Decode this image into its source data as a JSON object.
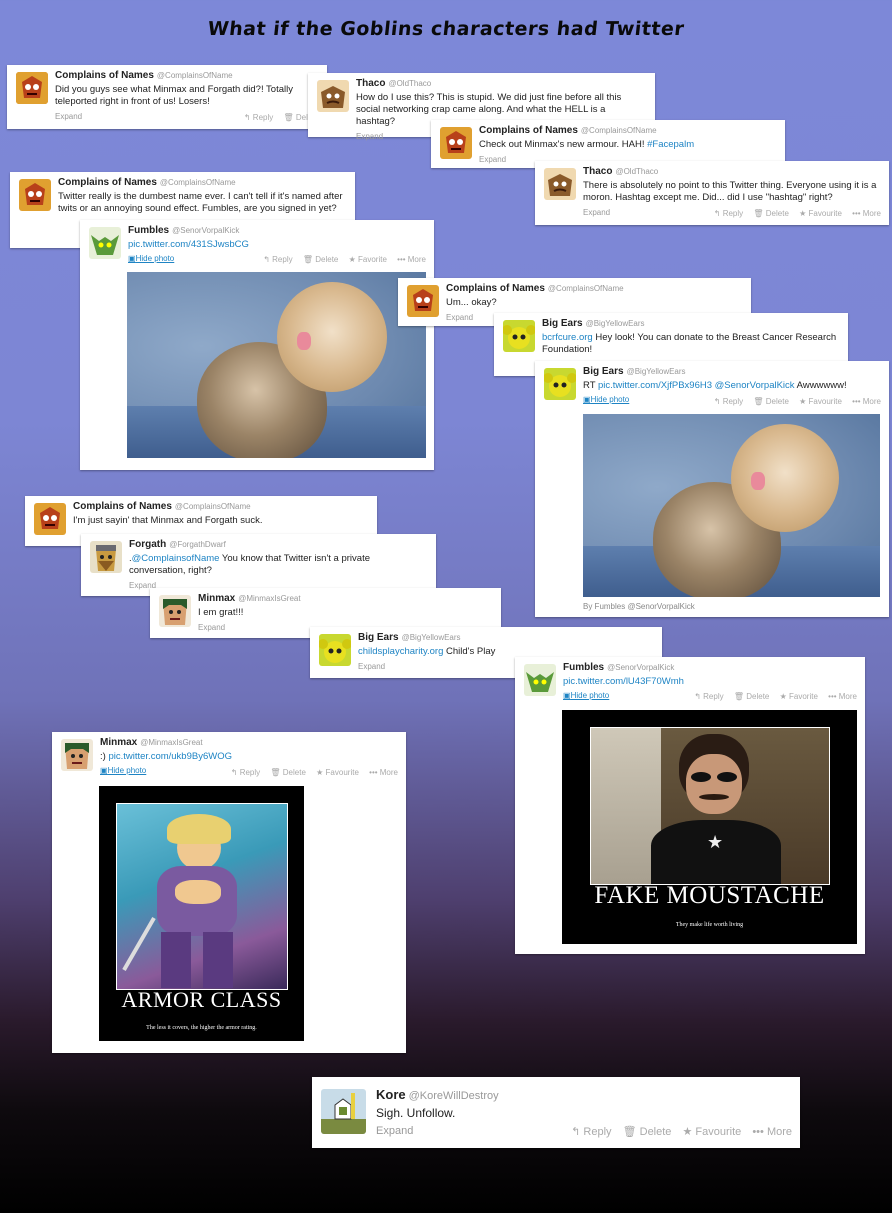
{
  "page_title": "What if the Goblins characters had Twitter",
  "actions": {
    "reply": "Reply",
    "delete": "Delete",
    "favorite": "Favorite",
    "favourite": "Favourite",
    "more": "More",
    "expand": "Expand",
    "hide_photo": "Hide photo"
  },
  "tweets": [
    {
      "name": "Complains of Names",
      "handle": "@ComplainsOfName",
      "text": "Did you guys see what Minmax and Forgath did?! Totally teleported right in front of us! Losers!"
    },
    {
      "name": "Thaco",
      "handle": "@OldThaco",
      "text": "How do I use this? This is stupid. We did just fine before all this social networking crap came along. And what the HELL is a hashtag?"
    },
    {
      "name": "Complains of Names",
      "handle": "@ComplainsOfName",
      "text": "Check out Minmax's new armour. HAH! ",
      "link": "#Facepalm"
    },
    {
      "name": "Thaco",
      "handle": "@OldThaco",
      "text": "There is absolutely no point to this Twitter thing. Everyone using it is a moron. Hashtag except me. Did... did I use \"hashtag\" right?"
    },
    {
      "name": "Complains of Names",
      "handle": "@ComplainsOfName",
      "text": "Twitter really is the dumbest name ever. I can't tell if it's named after twits or an annoying sound effect. Fumbles, are you signed in yet?"
    },
    {
      "name": "Fumbles",
      "handle": "@SenorVorpalKick",
      "link": "pic.twitter.com/431SJwsbCG"
    },
    {
      "name": "Complains of Names",
      "handle": "@ComplainsOfName",
      "text": "Um... okay?"
    },
    {
      "name": "Big Ears",
      "handle": "@BigYellowEars",
      "link": "bcrfcure.org",
      "text": "  Hey look! You can donate to the Breast Cancer Research Foundation!"
    },
    {
      "name": "Big Ears",
      "handle": "@BigYellowEars",
      "prefix": "RT ",
      "link": "pic.twitter.com/XjfPBx96H3",
      "link2": " @SenorVorpalKick",
      "text": " Awwwwww!",
      "byline": "By Fumbles @SenorVorpalKick"
    },
    {
      "name": "Complains of Names",
      "handle": "@ComplainsOfName",
      "text": "I'm just sayin' that Minmax and Forgath suck."
    },
    {
      "name": "Forgath",
      "handle": "@ForgathDwarf",
      "prefix": ".",
      "link": "@ComplainsofName",
      "text": " You know that Twitter isn't a private conversation, right?"
    },
    {
      "name": "Minmax",
      "handle": "@MinmaxIsGreat",
      "text": "I em grat!!!"
    },
    {
      "name": "Big Ears",
      "handle": "@BigYellowEars",
      "link": "childsplaycharity.org",
      "text": "  Child's Play"
    },
    {
      "name": "Fumbles",
      "handle": "@SenorVorpalKick",
      "link": "pic.twitter.com/lU43F70Wmh"
    },
    {
      "name": "Minmax",
      "handle": "@MinmaxIsGreat",
      "prefix": ":) ",
      "link": "pic.twitter.com/ukb9By6WOG"
    },
    {
      "name": "Kore",
      "handle": "@KoreWillDestroy",
      "text": "Sigh. Unfollow."
    }
  ],
  "posters": {
    "moustache": {
      "title": "FAKE MOUSTACHE",
      "subtitle": "They make life worth living"
    },
    "armor": {
      "title": "ARMOR CLASS",
      "subtitle": "The less it covers, the higher the armor rating."
    }
  },
  "colors": {
    "link": "#1e84c4",
    "handle": "#999999"
  }
}
